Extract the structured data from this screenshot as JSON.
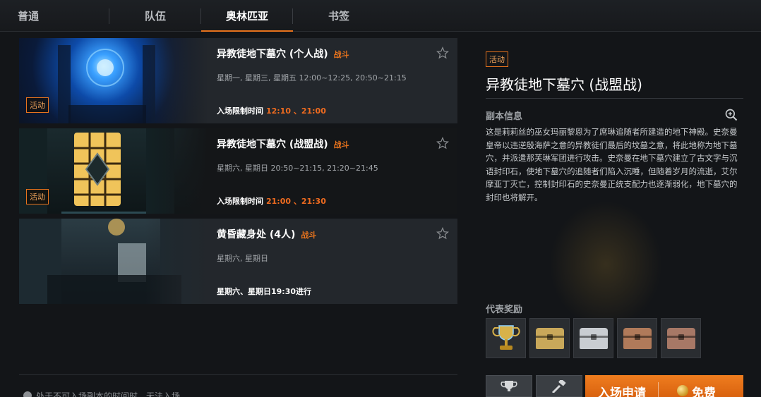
{
  "tabs": [
    {
      "label": "普通"
    },
    {
      "label": "队伍"
    },
    {
      "label": "奥林匹亚"
    },
    {
      "label": "书签"
    }
  ],
  "dungeons": [
    {
      "title": "异教徒地下墓穴 (个人战)",
      "tag": "战斗",
      "schedule": "星期一, 星期三, 星期五  12:00~12:25, 20:50~21:15",
      "entry_label": "入场限制时间",
      "entry_time": "12:10 、21:00",
      "badge": "活动"
    },
    {
      "title": "异教徒地下墓穴 (战盟战)",
      "tag": "战斗",
      "schedule": "星期六, 星期日  20:50~21:15, 21:20~21:45",
      "entry_label": "入场限制时间",
      "entry_time": "21:00 、21:30",
      "badge": "活动"
    },
    {
      "title": "黄昏藏身处 (4人)",
      "tag": "战斗",
      "schedule": "星期六, 星期日",
      "entry_label": "星期六、星期日19:30进行",
      "entry_time": "",
      "badge": ""
    }
  ],
  "notice": "处于不可入场副本的时间时，无法入场。",
  "detail": {
    "badge": "活动",
    "title": "异教徒地下墓穴 (战盟战)",
    "info_heading": "副本信息",
    "description": "这是莉莉丝的巫女玛丽黎恩为了席琳追随者所建造的地下神殿。史奈曼皇帝以违逆殷海萨之意的异教徒们最后的坟墓之意，将此地称为地下墓穴，并派遣那芙琳军团进行攻击。史奈曼在地下墓穴建立了古文字与沉语封印石，使地下墓穴的追随者们陷入沉睡，但随着岁月的流逝，艾尔摩亚丁灭亡，控制封印石的史奈曼正统支配力也逐渐弱化，地下墓穴的封印也将解开。",
    "reward_heading": "代表奖励",
    "rewards": [
      {
        "icon": "trophy-icon"
      },
      {
        "icon": "gold-chest-icon",
        "color": "#c9a85a"
      },
      {
        "icon": "silver-chest-icon",
        "color": "#c9cdd2"
      },
      {
        "icon": "bronze-chest-icon",
        "color": "#b07a5a"
      },
      {
        "icon": "copper-chest-icon",
        "color": "#a77866"
      }
    ],
    "enter_label": "入场申请",
    "cost_label": "免费"
  },
  "colors": {
    "accent": "#e7731d",
    "highlight": "#ef6b1f"
  }
}
